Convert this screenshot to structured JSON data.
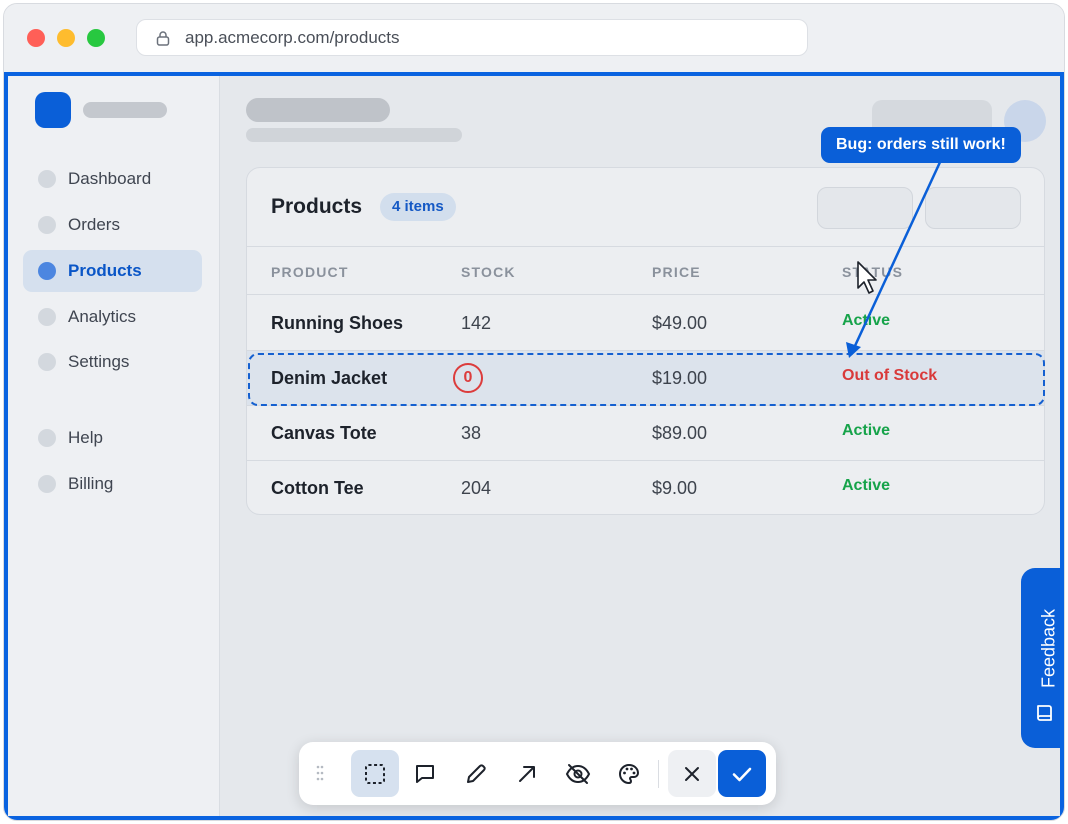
{
  "browser": {
    "url": "app.acmecorp.com/products"
  },
  "sidebar": {
    "items": [
      {
        "label": "Dashboard",
        "active": false
      },
      {
        "label": "Orders",
        "active": false
      },
      {
        "label": "Products",
        "active": true
      },
      {
        "label": "Analytics",
        "active": false
      },
      {
        "label": "Settings",
        "active": false
      }
    ],
    "secondary_items": [
      {
        "label": "Help"
      },
      {
        "label": "Billing"
      }
    ]
  },
  "card": {
    "title": "Products",
    "count_badge": "4 items",
    "columns": [
      "PRODUCT",
      "STOCK",
      "PRICE",
      "STATUS"
    ],
    "rows": [
      {
        "product": "Running Shoes",
        "stock": "142",
        "price": "$49.00",
        "status": "Active",
        "status_color": "#16a34a"
      },
      {
        "product": "Denim Jacket",
        "stock": "0",
        "price": "$19.00",
        "status": "Out of Stock",
        "status_color": "#d93a3a",
        "selected": true
      },
      {
        "product": "Canvas Tote",
        "stock": "38",
        "price": "$89.00",
        "status": "Active",
        "status_color": "#16a34a"
      },
      {
        "product": "Cotton Tee",
        "stock": "204",
        "price": "$9.00",
        "status": "Active",
        "status_color": "#16a34a"
      }
    ]
  },
  "annotation": {
    "callout": "Bug: orders still work!"
  },
  "feedback_tab": {
    "label": "Feedback",
    "icon": "book-icon"
  },
  "toolbar": {
    "tools": [
      {
        "name": "select-region",
        "icon": "dashed-rect-icon",
        "active": true
      },
      {
        "name": "comment",
        "icon": "speech-bubble-icon"
      },
      {
        "name": "draw",
        "icon": "pencil-icon"
      },
      {
        "name": "arrow",
        "icon": "arrow-icon"
      },
      {
        "name": "hide",
        "icon": "eye-off-icon"
      },
      {
        "name": "color",
        "icon": "palette-icon"
      }
    ],
    "cancel_icon": "close-icon",
    "confirm_icon": "check-icon"
  },
  "colors": {
    "accent": "#0a5fd8",
    "active_status": "#16a34a",
    "out_of_stock": "#d93a3a"
  }
}
